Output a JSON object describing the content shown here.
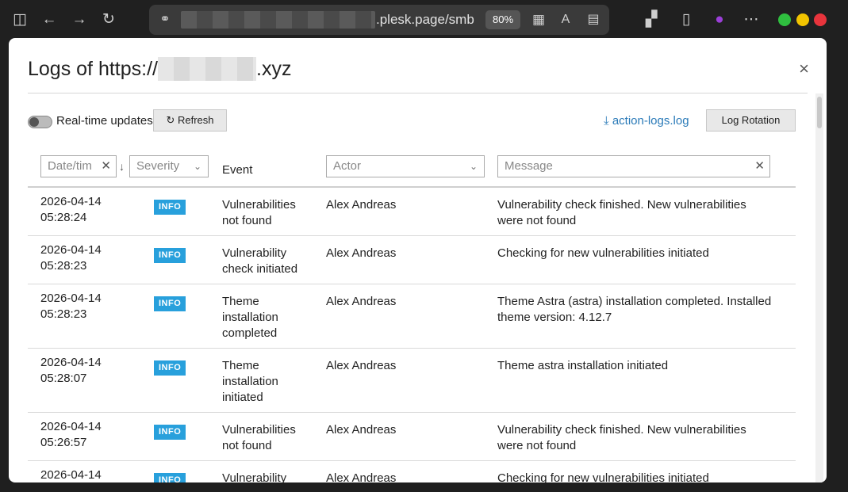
{
  "browser": {
    "url_suffix": ".plesk.page/smb",
    "zoom": "80%",
    "icons": [
      "sidebar-icon",
      "back-icon",
      "forward-icon",
      "reload-icon",
      "link-icon",
      "apps-icon",
      "translate-icon",
      "reader-icon",
      "extensions-icon",
      "document-icon",
      "profile-icon",
      "more-icon"
    ]
  },
  "dialog": {
    "title_prefix": "Logs of https://",
    "title_suffix": ".xyz",
    "close_symbol": "×"
  },
  "toolbar": {
    "realtime_label": "Real-time updates",
    "refresh_label": "Refresh",
    "download_label": "action-logs.log",
    "rotation_label": "Log Rotation"
  },
  "filters": {
    "date_placeholder": "Date/tim",
    "severity_placeholder": "Severity",
    "event_header": "Event",
    "actor_placeholder": "Actor",
    "message_placeholder": "Message"
  },
  "rows": [
    {
      "date": "2026-04-14",
      "time": "05:28:24",
      "severity": "INFO",
      "event": "Vulnerabilities not found",
      "actor": "Alex Andreas",
      "message": "Vulnerability check finished. New vulnerabilities were not found"
    },
    {
      "date": "2026-04-14",
      "time": "05:28:23",
      "severity": "INFO",
      "event": "Vulnerability check initiated",
      "actor": "Alex Andreas",
      "message": "Checking for new vulnerabilities initiated"
    },
    {
      "date": "2026-04-14",
      "time": "05:28:23",
      "severity": "INFO",
      "event": "Theme installation completed",
      "actor": "Alex Andreas",
      "message": "Theme Astra (astra) installation completed. Installed theme version: 4.12.7"
    },
    {
      "date": "2026-04-14",
      "time": "05:28:07",
      "severity": "INFO",
      "event": "Theme installation initiated",
      "actor": "Alex Andreas",
      "message": "Theme astra installation initiated"
    },
    {
      "date": "2026-04-14",
      "time": "05:26:57",
      "severity": "INFO",
      "event": "Vulnerabilities not found",
      "actor": "Alex Andreas",
      "message": "Vulnerability check finished. New vulnerabilities were not found"
    },
    {
      "date": "2026-04-14",
      "time": "",
      "severity": "INFO",
      "event": "Vulnerability",
      "actor": "Alex Andreas",
      "message": "Checking for new vulnerabilities initiated"
    }
  ]
}
